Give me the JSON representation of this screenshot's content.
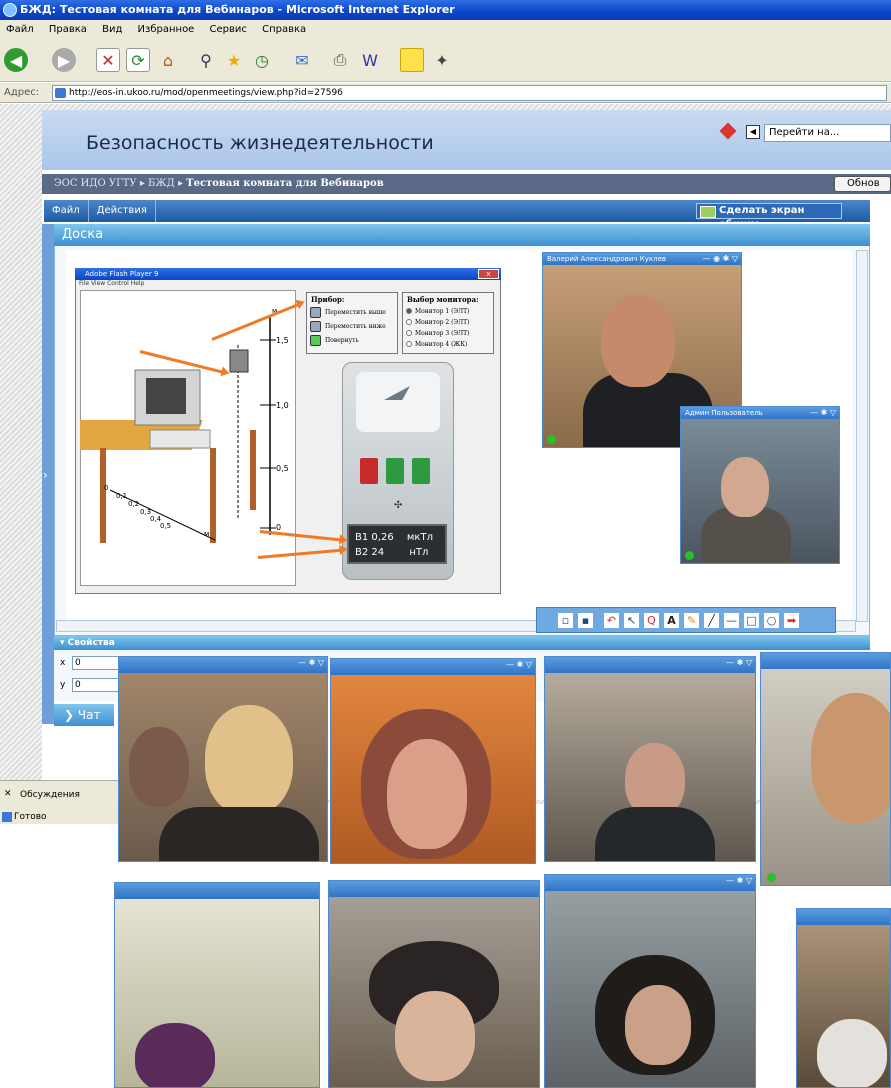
{
  "window": {
    "title": "БЖД: Тестовая комната для Вебинаров - Microsoft Internet Explorer"
  },
  "menu": [
    "Файл",
    "Правка",
    "Вид",
    "Избранное",
    "Сервис",
    "Справка"
  ],
  "toolbar_icons": [
    "back-icon",
    "forward-icon",
    "stop-icon",
    "refresh-icon",
    "home-icon",
    "search-icon",
    "favorites-icon",
    "history-icon",
    "mail-icon",
    "print-icon",
    "edit-icon",
    "notes-icon",
    "messenger-icon"
  ],
  "address": {
    "label": "Адрес:",
    "url": "http://eos-in.ukoo.ru/mod/openmeetings/view.php?id=27596"
  },
  "site": {
    "name": "Безопасность жизнедеятельности",
    "goto_label": "Перейти на...",
    "breadcrumb": [
      "ЭОС ИДО УГТУ",
      "БЖД",
      "Тестовая комната для Вебинаров"
    ],
    "refresh_button": "Обнов"
  },
  "meeting": {
    "menu": [
      "Файл",
      "Действия"
    ],
    "share_button": "Сделать экран общим",
    "board_title": "Доска",
    "props_title": "Свойства",
    "x_label": "x",
    "y_label": "y",
    "x_value": "0",
    "y_value": "0",
    "chat_label": "Чат"
  },
  "flash": {
    "title": "Adobe Flash Player 9",
    "menu": "File  View  Control  Help",
    "device_panel_title": "Прибор:",
    "device_actions": [
      "Переместить выше",
      "Переместить ниже",
      "Повернуть"
    ],
    "monitor_panel_title": "Выбор монитора:",
    "monitors": [
      "Монитор 1 (ЭЛТ)",
      "Монитор 2 (ЭЛТ)",
      "Монитор 3 (ЭЛТ)",
      "Монитор 4 (ЖК)"
    ],
    "scale_labels": [
      "1,5",
      "1,0",
      "0,5",
      "0"
    ],
    "axis_labels": [
      "0",
      "0,1",
      "0,2",
      "0,3",
      "0,4",
      "0,5"
    ],
    "axis_h": "м",
    "axis_x": "м",
    "display": {
      "b1_label": "B1",
      "b1_value": "0,26",
      "b1_unit": "мкТл",
      "b2_label": "B2",
      "b2_value": "24",
      "b2_unit": "нТл"
    }
  },
  "participants": {
    "main": "Валерий Александрович Куклев",
    "admin": "Админ Пользователь"
  },
  "taskbar": {
    "discussions": "Обсуждения",
    "status": "Готово"
  },
  "colors": {
    "accent_blue": "#3d8fd0",
    "titlebar": "#0a45c8",
    "arrow_orange": "#f07a26",
    "online_green": "#27c22b"
  }
}
